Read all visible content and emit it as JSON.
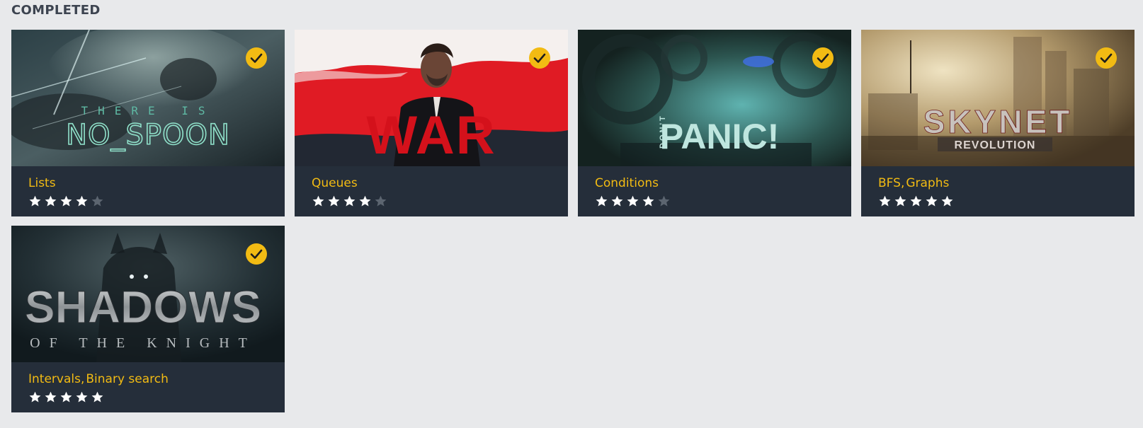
{
  "section": {
    "title": "COMPLETED"
  },
  "colors": {
    "accent": "#f2bb13",
    "card_bg": "#252e3a",
    "star_on": "#ffffff",
    "star_off": "#5c6570"
  },
  "puzzles": [
    {
      "id": "no-spoon",
      "art_title_top": "THERE IS",
      "art_title_main": "NO_SPOON",
      "tags": [
        "Lists"
      ],
      "rating": 4,
      "completed": true,
      "check_icon": "check-badge-icon"
    },
    {
      "id": "war",
      "art_title_main": "WAR",
      "tags": [
        "Queues"
      ],
      "rating": 4,
      "completed": true,
      "check_icon": "check-badge-icon"
    },
    {
      "id": "dont-panic",
      "art_title_top": "DON'T",
      "art_title_main": "PANIC!",
      "tags": [
        "Conditions"
      ],
      "rating": 4,
      "completed": true,
      "check_icon": "check-badge-icon"
    },
    {
      "id": "skynet",
      "art_title_main": "SKYNET",
      "art_title_sub": "REVOLUTION",
      "tags": [
        "BFS",
        "Graphs"
      ],
      "rating": 5,
      "completed": true,
      "check_icon": "check-badge-icon"
    },
    {
      "id": "shadows",
      "art_title_main": "SHADOWS",
      "art_title_sub": "OF THE KNIGHT",
      "tags": [
        "Intervals",
        "Binary search"
      ],
      "rating": 5,
      "completed": true,
      "check_icon": "check-badge-icon"
    }
  ]
}
